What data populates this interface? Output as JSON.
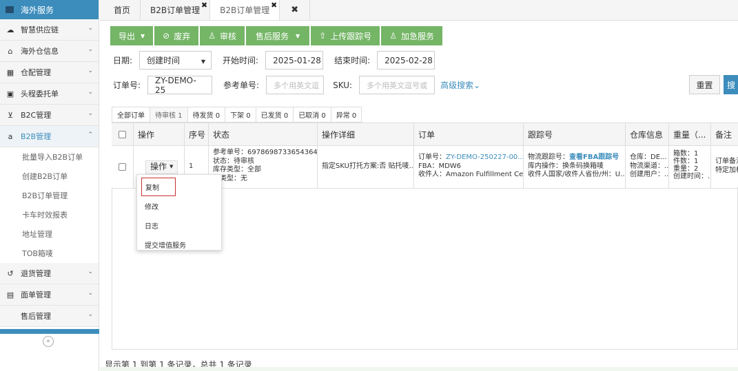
{
  "sidebar": {
    "top": "海外服务",
    "items": [
      {
        "label": "智慧供应链",
        "icon": "cloud-icon"
      },
      {
        "label": "海外仓信息",
        "icon": "home-icon"
      },
      {
        "label": "仓配管理",
        "icon": "grid-icon"
      },
      {
        "label": "头程委托单",
        "icon": "briefcase-icon"
      },
      {
        "label": "B2C管理",
        "icon": "cart-icon"
      },
      {
        "label": "B2B管理",
        "icon": "amazon-icon"
      }
    ],
    "sub_items": [
      "批量导入B2B订单",
      "创建B2B订单",
      "B2B订单管理",
      "卡车时效报表",
      "地址管理",
      "TOB箱唛"
    ],
    "bottom_items": [
      {
        "label": "退货管理",
        "icon": "return-icon"
      },
      {
        "label": "面单管理",
        "icon": "doc-icon"
      },
      {
        "label": "售后管理",
        "icon": ""
      }
    ],
    "collapse": "«"
  },
  "tabs": [
    {
      "label": "首页"
    },
    {
      "label": "B2B订单管理"
    },
    {
      "label": "B2B订单管理"
    }
  ],
  "toolbar": {
    "export": "导出",
    "discard": "废弃",
    "audit": "审核",
    "aftersale": "售后服务",
    "upload": "上传跟踪号",
    "urgent": "加急服务"
  },
  "filters": {
    "date_label": "日期:",
    "date_type": "创建时间",
    "start_label": "开始时间:",
    "start_value": "2025-01-28",
    "end_label": "结束时间:",
    "end_value": "2025-02-28",
    "order_label": "订单号:",
    "order_value": "ZY-DEMO-25",
    "ref_label": "参考单号:",
    "ref_placeholder": "多个用英文逗",
    "sku_label": "SKU:",
    "sku_placeholder": "多个用英文逗号或",
    "advanced": "高级搜索",
    "reset": "重置",
    "search": "搜"
  },
  "status_tabs": [
    "全部订单",
    "待审核 1",
    "待发货 0",
    "下架 0",
    "已发货 0",
    "已取消 0",
    "异常 0"
  ],
  "table": {
    "headers": [
      "",
      "操作",
      "序号",
      "状态",
      "操作详细",
      "订单",
      "跟踪号",
      "仓库信息",
      "重量（...",
      "备注"
    ],
    "row": {
      "op": "操作",
      "seq": "1",
      "status": [
        "参考单号：6978698733654364...",
        "状态：待审核",
        "库存类型：全部",
        "物类型：无"
      ],
      "detail": "指定SKU打托方案:否 贴托唛...",
      "order_label": "订单号：",
      "order_link": "ZY-DEMO-250227-00...",
      "fba": "FBA：MDW6",
      "receiver": "收件人：Amazon Fulfillment Ce...",
      "track_label": "物流跟踪号：",
      "track_link": "查看FBA跟踪号",
      "track2": "库内操作：换条码换箱唛",
      "track3": "收件人国家/收件人省份/州：U...",
      "wh1": "仓库：DE...",
      "wh2": "物流渠道：..",
      "wh3": "创建用户：..",
      "wt1": "箱数：1",
      "wt2": "件数：1",
      "wt3": "重量：2",
      "wt4": "创建时间：..",
      "note1": "订单备注",
      "note2": "特定加标"
    }
  },
  "dropdown": [
    "复制",
    "修改",
    "日志",
    "提交增值服务"
  ],
  "footer": "显示第 1 到第 1 条记录，总共 1 条记录"
}
